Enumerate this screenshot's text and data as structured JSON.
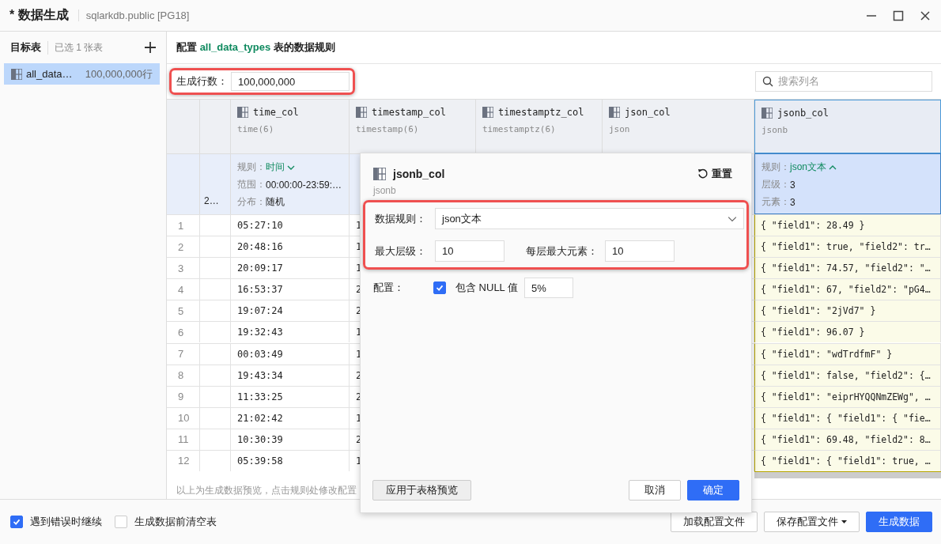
{
  "window": {
    "title": "* 数据生成",
    "subtitle": "sqlarkdb.public [PG18]"
  },
  "sidebar": {
    "title": "目标表",
    "count": "已选 1 张表",
    "items": [
      {
        "name": "all_data…",
        "rows": "100,000,000行",
        "selected": true
      }
    ]
  },
  "config_header": {
    "prefix": "配置",
    "table": "all_data_types",
    "suffix": "表的数据规则"
  },
  "row_count": {
    "label": "生成行数：",
    "value": "100,000,000"
  },
  "search": {
    "placeholder": "搜索列名"
  },
  "columns": [
    {
      "name": "time_col",
      "type": "time(6)",
      "highlighted": false
    },
    {
      "name": "timestamp_col",
      "type": "timestamp(6)",
      "highlighted": false
    },
    {
      "name": "timestamptz_col",
      "type": "timestamptz(6)",
      "highlighted": false
    },
    {
      "name": "json_col",
      "type": "json",
      "highlighted": false
    },
    {
      "name": "jsonb_col",
      "type": "jsonb",
      "highlighted": true
    }
  ],
  "rules": {
    "column_2": "2…",
    "time_col": [
      {
        "label": "规则：",
        "value": "时间",
        "kind": "dropdown",
        "expanded": false
      },
      {
        "label": "范围：",
        "value": "00:00:00-23:59:…",
        "kind": "text"
      },
      {
        "label": "分布：",
        "value": "随机",
        "kind": "text"
      }
    ],
    "jsonb_col": [
      {
        "label": "规则：",
        "value": "json文本",
        "kind": "dropdown",
        "expanded": true
      },
      {
        "label": "层级：",
        "value": "3",
        "kind": "text"
      },
      {
        "label": "元素：",
        "value": "3",
        "kind": "text"
      }
    ]
  },
  "rows": [
    {
      "num": "1",
      "time": "05:27:10",
      "timestamp": "1",
      "jsonb": "{ \"field1\": 28.49 }"
    },
    {
      "num": "2",
      "time": "20:48:16",
      "timestamp": "1",
      "jsonb": "{ \"field1\": true, \"field2\": tr…"
    },
    {
      "num": "3",
      "time": "20:09:17",
      "timestamp": "1",
      "jsonb": "{ \"field1\": 74.57, \"field2\": \"…"
    },
    {
      "num": "4",
      "time": "16:53:37",
      "timestamp": "2",
      "jsonb": "{ \"field1\": 67, \"field2\": \"pG4…"
    },
    {
      "num": "5",
      "time": "19:07:24",
      "timestamp": "2",
      "jsonb": "{ \"field1\": \"2jVd7\" }"
    },
    {
      "num": "6",
      "time": "19:32:43",
      "timestamp": "1",
      "jsonb": "{ \"field1\": 96.07 }"
    },
    {
      "num": "7",
      "time": "00:03:49",
      "timestamp": "1",
      "jsonb": "{ \"field1\": \"wdTrdfmF\" }"
    },
    {
      "num": "8",
      "time": "19:43:34",
      "timestamp": "2",
      "jsonb": "{ \"field1\": false, \"field2\": {…"
    },
    {
      "num": "9",
      "time": "11:33:25",
      "timestamp": "2",
      "jsonb": "{ \"field1\": \"eiprHYQQNmZEWg\", …"
    },
    {
      "num": "10",
      "time": "21:02:42",
      "timestamp": "1",
      "jsonb": "{ \"field1\": { \"field1\": { \"fie…"
    },
    {
      "num": "11",
      "time": "10:30:39",
      "timestamp": "2",
      "jsonb": "{ \"field1\": 69.48, \"field2\": 8…"
    },
    {
      "num": "12",
      "time": "05:39:58",
      "timestamp": "1",
      "jsonb": "{ \"field1\": { \"field1\": true, …"
    }
  ],
  "footnote": "以上为生成数据预览，点击规则处修改配置",
  "popup": {
    "title": "jsonb_col",
    "type": "jsonb",
    "reset": "重置",
    "rule": {
      "label": "数据规则：",
      "value": "json文本"
    },
    "max_depth": {
      "label": "最大层级：",
      "value": "10"
    },
    "max_elements": {
      "label": "每层最大元素：",
      "value": "10"
    },
    "config": {
      "label": "配置：",
      "checked": true,
      "option": "包含 NULL 值",
      "value": "5%"
    },
    "apply": "应用于表格预览",
    "cancel": "取消",
    "ok": "确定"
  },
  "footer": {
    "options": [
      {
        "label": "遇到错误时继续",
        "checked": true
      },
      {
        "label": "生成数据前清空表",
        "checked": false
      }
    ],
    "buttons": [
      {
        "label": "加载配置文件",
        "kind": "default"
      },
      {
        "label": "保存配置文件",
        "kind": "menu"
      },
      {
        "label": "生成数据",
        "kind": "primary"
      }
    ]
  }
}
